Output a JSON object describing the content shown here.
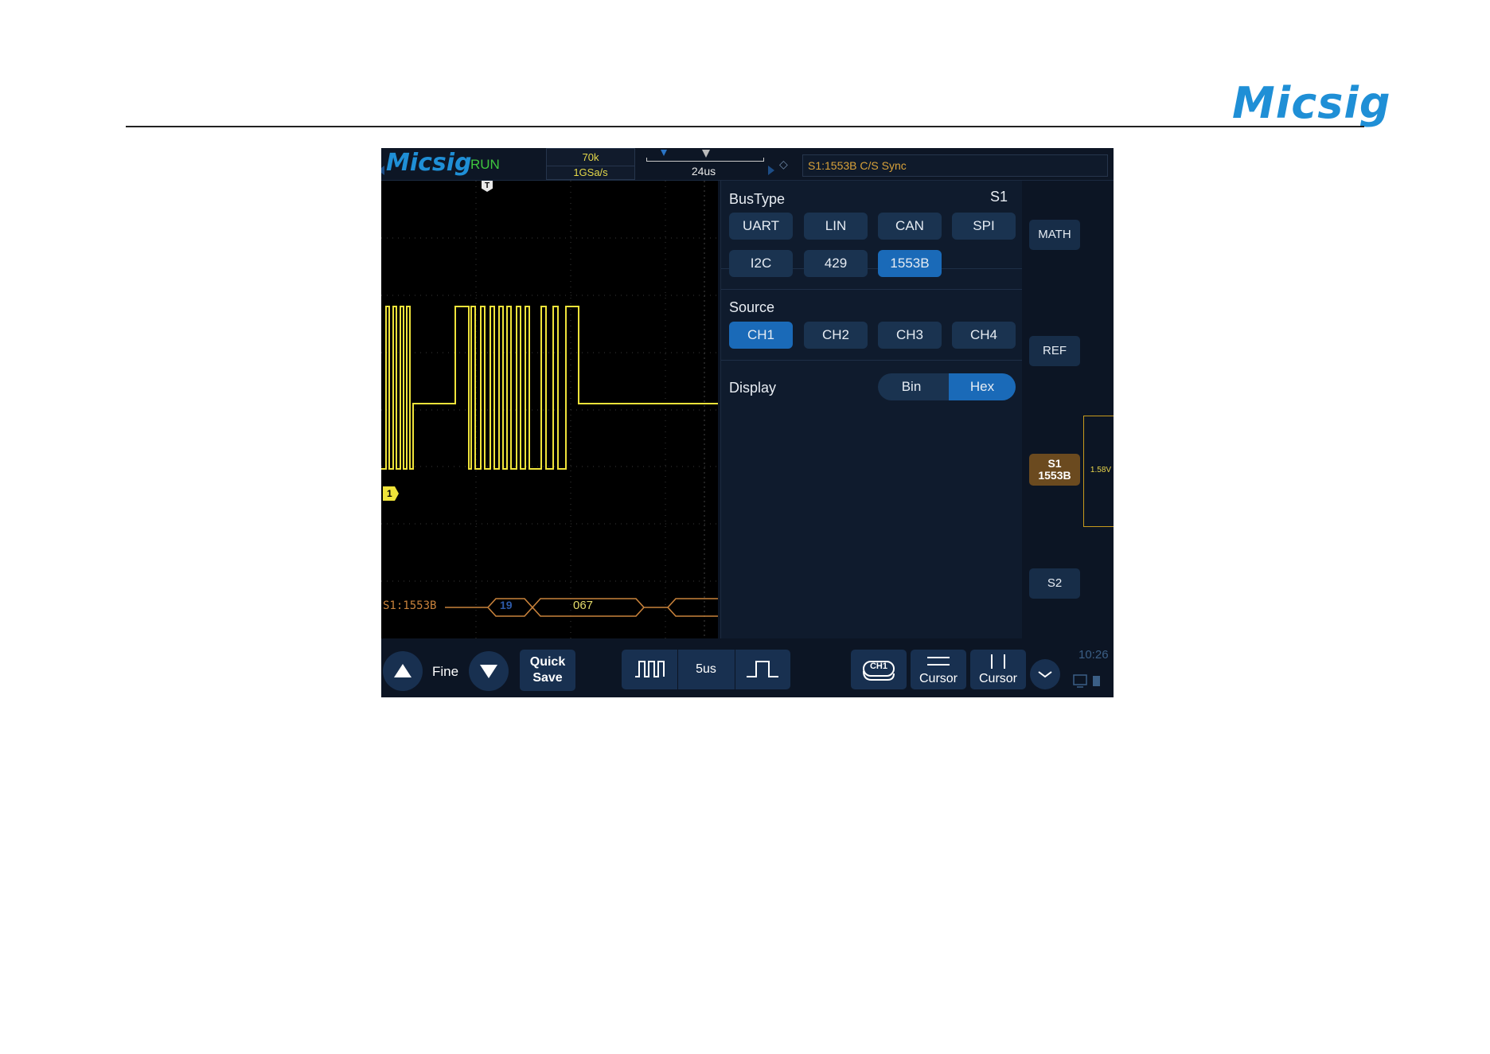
{
  "doc": {
    "logo": "Micsig"
  },
  "scope": {
    "brand": "Micsig",
    "run_state": "RUN",
    "memory_depth": "70k",
    "sample_rate": "1GSa/s",
    "time_position": "24us",
    "trigger_info": "S1:1553B C/S Sync",
    "bus_label": "S1:1553B",
    "bus_value_1": "19",
    "bus_value_2": "067",
    "channel_marker": "1",
    "trigger_marker": "T"
  },
  "panel": {
    "bustype": {
      "title": "BusType",
      "tag": "S1",
      "options": [
        "UART",
        "LIN",
        "CAN",
        "SPI",
        "I2C",
        "429",
        "1553B"
      ],
      "selected": "1553B"
    },
    "source": {
      "title": "Source",
      "options": [
        "CH1",
        "CH2",
        "CH3",
        "CH4"
      ],
      "selected": "CH1"
    },
    "display": {
      "title": "Display",
      "options": [
        "Bin",
        "Hex"
      ],
      "selected": "Hex"
    }
  },
  "side": {
    "math": "MATH",
    "ref": "REF",
    "s1_line1": "S1",
    "s1_line2": "1553B",
    "s2": "S2",
    "trigger_level": "1.58V"
  },
  "bottom": {
    "fine": "Fine",
    "quick_save_1": "Quick",
    "quick_save_2": "Save",
    "timebase": "5us",
    "ch_select": "CH1",
    "cursor_h": "Cursor",
    "cursor_v": "Cursor",
    "clock": "10:26"
  },
  "colors": {
    "ch1": "#efe33a",
    "bus": "#c8823b",
    "accent": "#1a6ab8",
    "run": "#3ec63e"
  }
}
